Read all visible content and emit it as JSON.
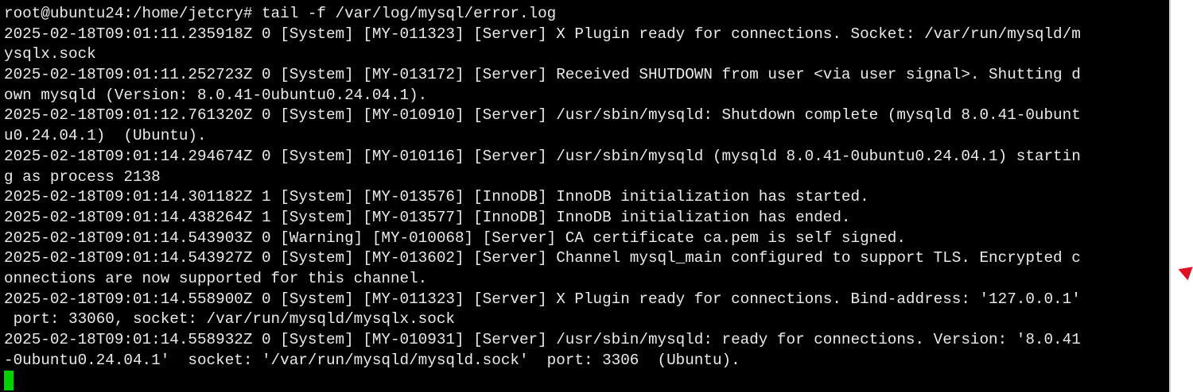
{
  "terminal": {
    "lines": [
      "root@ubuntu24:/home/jetcry# tail -f /var/log/mysql/error.log",
      "2025-02-18T09:01:11.235918Z 0 [System] [MY-011323] [Server] X Plugin ready for connections. Socket: /var/run/mysqld/m",
      "ysqlx.sock",
      "2025-02-18T09:01:11.252723Z 0 [System] [MY-013172] [Server] Received SHUTDOWN from user <via user signal>. Shutting d",
      "own mysqld (Version: 8.0.41-0ubuntu0.24.04.1).",
      "2025-02-18T09:01:12.761320Z 0 [System] [MY-010910] [Server] /usr/sbin/mysqld: Shutdown complete (mysqld 8.0.41-0ubunt",
      "u0.24.04.1)  (Ubuntu).",
      "2025-02-18T09:01:14.294674Z 0 [System] [MY-010116] [Server] /usr/sbin/mysqld (mysqld 8.0.41-0ubuntu0.24.04.1) startin",
      "g as process 2138",
      "2025-02-18T09:01:14.301182Z 1 [System] [MY-013576] [InnoDB] InnoDB initialization has started.",
      "2025-02-18T09:01:14.438264Z 1 [System] [MY-013577] [InnoDB] InnoDB initialization has ended.",
      "2025-02-18T09:01:14.543903Z 0 [Warning] [MY-010068] [Server] CA certificate ca.pem is self signed.",
      "2025-02-18T09:01:14.543927Z 0 [System] [MY-013602] [Server] Channel mysql_main configured to support TLS. Encrypted c",
      "onnections are now supported for this channel.",
      "2025-02-18T09:01:14.558900Z 0 [System] [MY-011323] [Server] X Plugin ready for connections. Bind-address: '127.0.0.1'",
      " port: 33060, socket: /var/run/mysqld/mysqlx.sock",
      "2025-02-18T09:01:14.558932Z 0 [System] [MY-010931] [Server] /usr/sbin/mysqld: ready for connections. Version: '8.0.41",
      "-0ubuntu0.24.04.1'  socket: '/var/run/mysqld/mysqld.sock'  port: 3306  (Ubuntu)."
    ],
    "background_color": "#000000",
    "text_color": "#ebebeb",
    "cursor_color": "#00d200"
  },
  "icons": {
    "pointer": "mouse-pointer-icon"
  }
}
